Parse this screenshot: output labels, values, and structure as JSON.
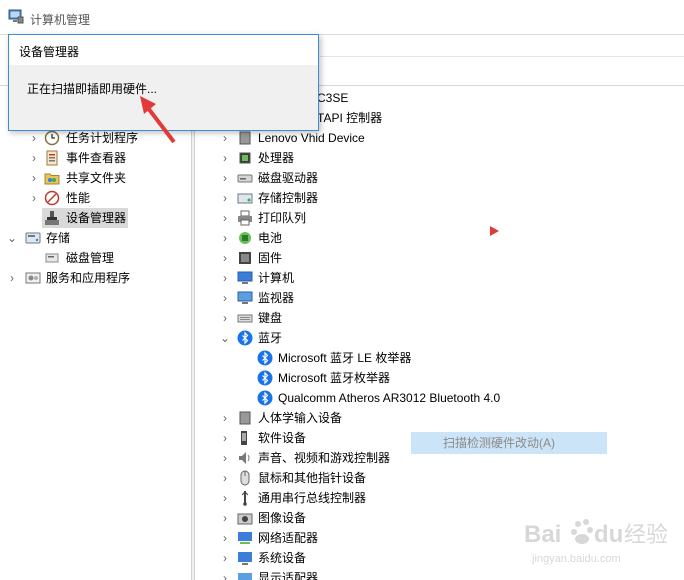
{
  "window": {
    "title": "计算机管理"
  },
  "dialog": {
    "title": "设备管理器",
    "message": "正在扫描即插即用硬件..."
  },
  "left_tree": [
    {
      "label": "任务计划程序",
      "icon": "clock-icon"
    },
    {
      "label": "事件查看器",
      "icon": "event-viewer-icon"
    },
    {
      "label": "共享文件夹",
      "icon": "shared-folder-icon"
    },
    {
      "label": "性能",
      "icon": "performance-icon"
    },
    {
      "label": "设备管理器",
      "icon": "device-manager-icon",
      "selected": true
    },
    {
      "label": "存储",
      "icon": "storage-icon"
    },
    {
      "label": "磁盘管理",
      "icon": "disk-management-icon"
    },
    {
      "label": "服务和应用程序",
      "icon": "services-icon"
    }
  ],
  "device_tree": {
    "partial_rows": [
      "C3SE",
      "TAPI 控制器"
    ],
    "items": [
      {
        "label": "Lenovo Vhid Device",
        "icon": "hid-icon"
      },
      {
        "label": "处理器",
        "icon": "processor-icon"
      },
      {
        "label": "磁盘驱动器",
        "icon": "disk-drive-icon"
      },
      {
        "label": "存储控制器",
        "icon": "storage-controller-icon"
      },
      {
        "label": "打印队列",
        "icon": "printer-icon"
      },
      {
        "label": "电池",
        "icon": "battery-icon"
      },
      {
        "label": "固件",
        "icon": "firmware-icon"
      },
      {
        "label": "计算机",
        "icon": "computer-icon"
      },
      {
        "label": "监视器",
        "icon": "monitor-icon"
      },
      {
        "label": "键盘",
        "icon": "keyboard-icon"
      },
      {
        "label": "蓝牙",
        "icon": "bluetooth-icon",
        "expanded": true
      },
      {
        "label": "Microsoft 蓝牙 LE 枚举器",
        "icon": "bluetooth-icon",
        "child": true
      },
      {
        "label": "Microsoft 蓝牙枚举器",
        "icon": "bluetooth-icon",
        "child": true
      },
      {
        "label": "Qualcomm Atheros AR3012 Bluetooth 4.0",
        "icon": "bluetooth-icon",
        "child": true
      },
      {
        "label": "人体学输入设备",
        "icon": "hid-icon"
      },
      {
        "label": "软件设备",
        "icon": "software-device-icon"
      },
      {
        "label": "声音、视频和游戏控制器",
        "icon": "speaker-icon"
      },
      {
        "label": "鼠标和其他指针设备",
        "icon": "mouse-icon"
      },
      {
        "label": "通用串行总线控制器",
        "icon": "usb-icon"
      },
      {
        "label": "图像设备",
        "icon": "camera-icon"
      },
      {
        "label": "网络适配器",
        "icon": "network-icon"
      },
      {
        "label": "系统设备",
        "icon": "system-device-icon"
      },
      {
        "label": "显示适配器",
        "icon": "display-adapter-icon"
      }
    ]
  },
  "context_menu": {
    "scan_label": "扫描检测硬件改动(A)"
  },
  "watermark": {
    "text": "Baidu 经验",
    "sub": "jingyan.baidu.com"
  },
  "colors": {
    "accent": "#3c8dd8",
    "bluetooth": "#1a73e8",
    "highlight": "#cce4f7",
    "annotation": "#e23a3a"
  }
}
